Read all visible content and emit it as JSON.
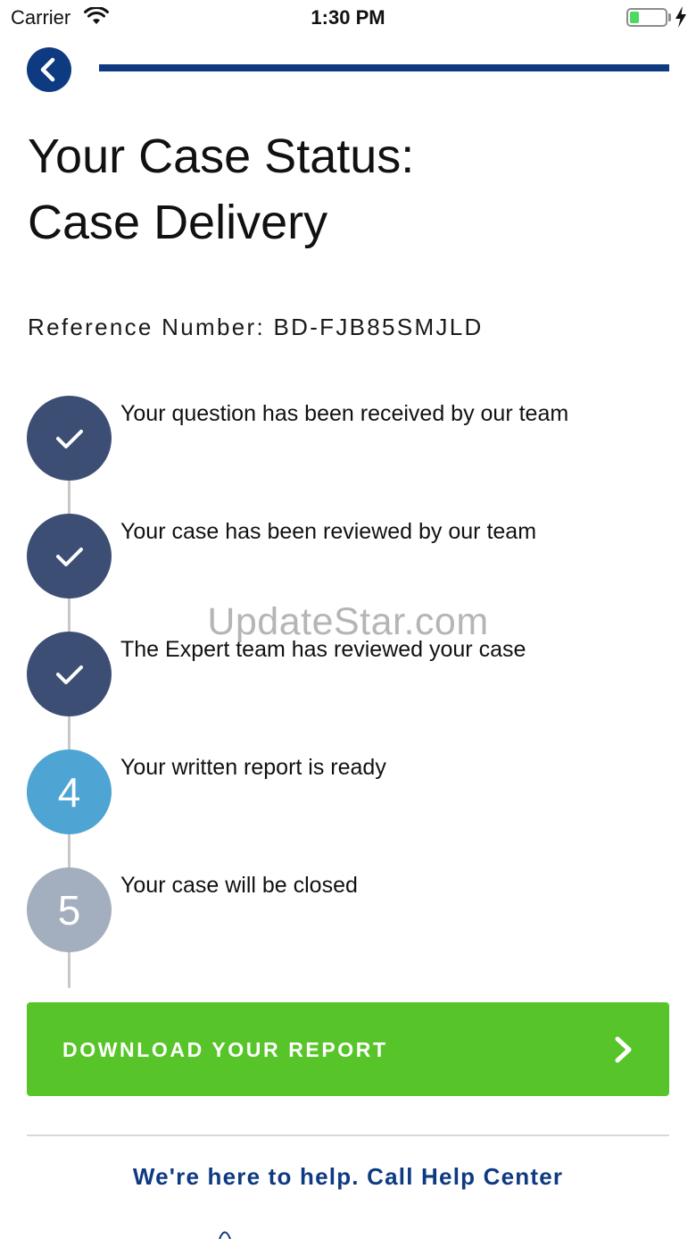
{
  "status_bar": {
    "carrier": "Carrier",
    "time": "1:30 PM",
    "wifi_icon": "wifi-icon",
    "battery_icon": "battery-charging-icon",
    "battery_level": 0.25
  },
  "header": {
    "back_icon": "chevron-left-icon",
    "progress": 1.0
  },
  "title": {
    "line1": "Your Case Status:",
    "line2": "Case Delivery"
  },
  "reference": {
    "text": "Reference Number: BD-FJB85SMJLD"
  },
  "steps": [
    {
      "marker": "",
      "icon": "check-icon",
      "state": "done",
      "label": "Your question has been received by our team"
    },
    {
      "marker": "",
      "icon": "check-icon",
      "state": "done",
      "label": "Your case has been reviewed by our team"
    },
    {
      "marker": "",
      "icon": "check-icon",
      "state": "done",
      "label": "The Expert team has reviewed your case"
    },
    {
      "marker": "4",
      "state": "current",
      "label": "Your written report is ready"
    },
    {
      "marker": "5",
      "state": "upcoming",
      "label": "Your case will be closed"
    }
  ],
  "watermark": "UpdateStar.com",
  "download_button": {
    "label": "DOWNLOAD YOUR REPORT",
    "icon": "chevron-right-icon"
  },
  "help": {
    "text": "We're here to help. Call Help Center"
  },
  "colors": {
    "brand_blue": "#0e3a82",
    "step_done": "#3d4e75",
    "step_current": "#4ea4d3",
    "step_upcoming": "#a3afbe",
    "download_green": "#57c529"
  }
}
